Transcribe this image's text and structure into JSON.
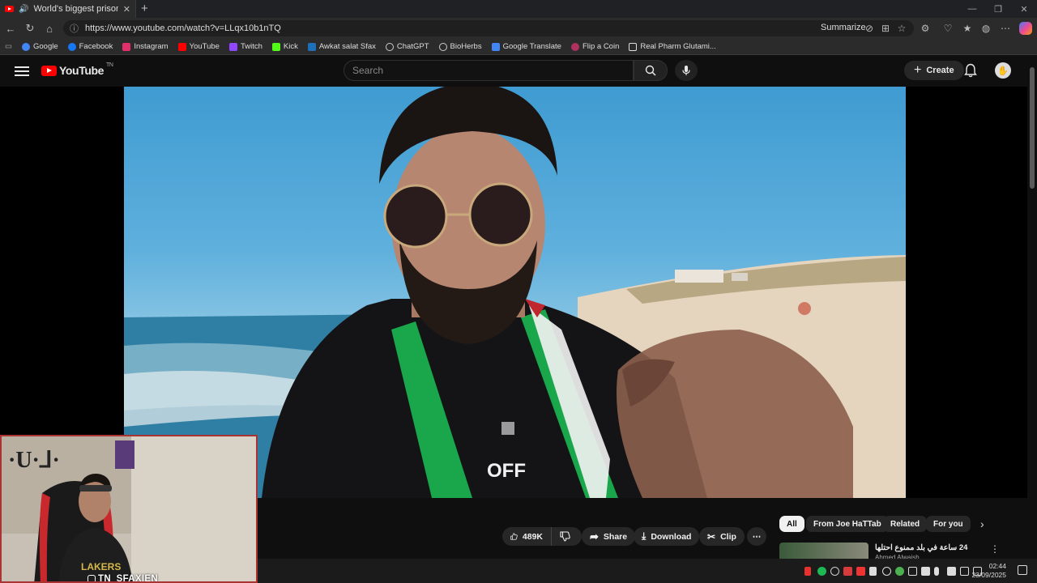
{
  "browser": {
    "tab_title": "World's biggest prison - GA",
    "url": "https://www.youtube.com/watch?v=LLqx10b1nTQ",
    "summarize_label": "Summarize",
    "bookmarks": [
      {
        "label": "Google",
        "color": "#4285f4"
      },
      {
        "label": "Facebook",
        "color": "#1877f2"
      },
      {
        "label": "Instagram",
        "color": "#e1306c"
      },
      {
        "label": "YouTube",
        "color": "#ff0000"
      },
      {
        "label": "Twitch",
        "color": "#9146ff"
      },
      {
        "label": "Kick",
        "color": "#53fc18"
      },
      {
        "label": "Awkat salat Sfax",
        "color": "#1d6fb8"
      },
      {
        "label": "ChatGPT",
        "color": "#cccccc"
      },
      {
        "label": "BioHerbs",
        "color": "#cccccc"
      },
      {
        "label": "Google Translate",
        "color": "#4285f4"
      },
      {
        "label": "Flip a Coin",
        "color": "#b03060"
      },
      {
        "label": "Real Pharm Glutami...",
        "color": "#dddddd"
      }
    ]
  },
  "youtube": {
    "logo_text": "YouTube",
    "country_code": "TN",
    "search_placeholder": "Search",
    "create_label": "Create",
    "likes": "489K",
    "share_label": "Share",
    "download_label": "Download",
    "clip_label": "Clip",
    "chips": [
      "All",
      "From Joe HaTTab",
      "Related",
      "For you"
    ],
    "rec_title": "24 ساعة في بلد ممنوع احتلها",
    "rec_channel": "Ahmed Alwaish",
    "video_shirt_text": "OFF"
  },
  "webcam": {
    "handle": "TN_SFAXIEN",
    "jersey_text": "LAKERS"
  },
  "taskbar": {
    "time": "02:44",
    "date": "23/09/2025"
  }
}
